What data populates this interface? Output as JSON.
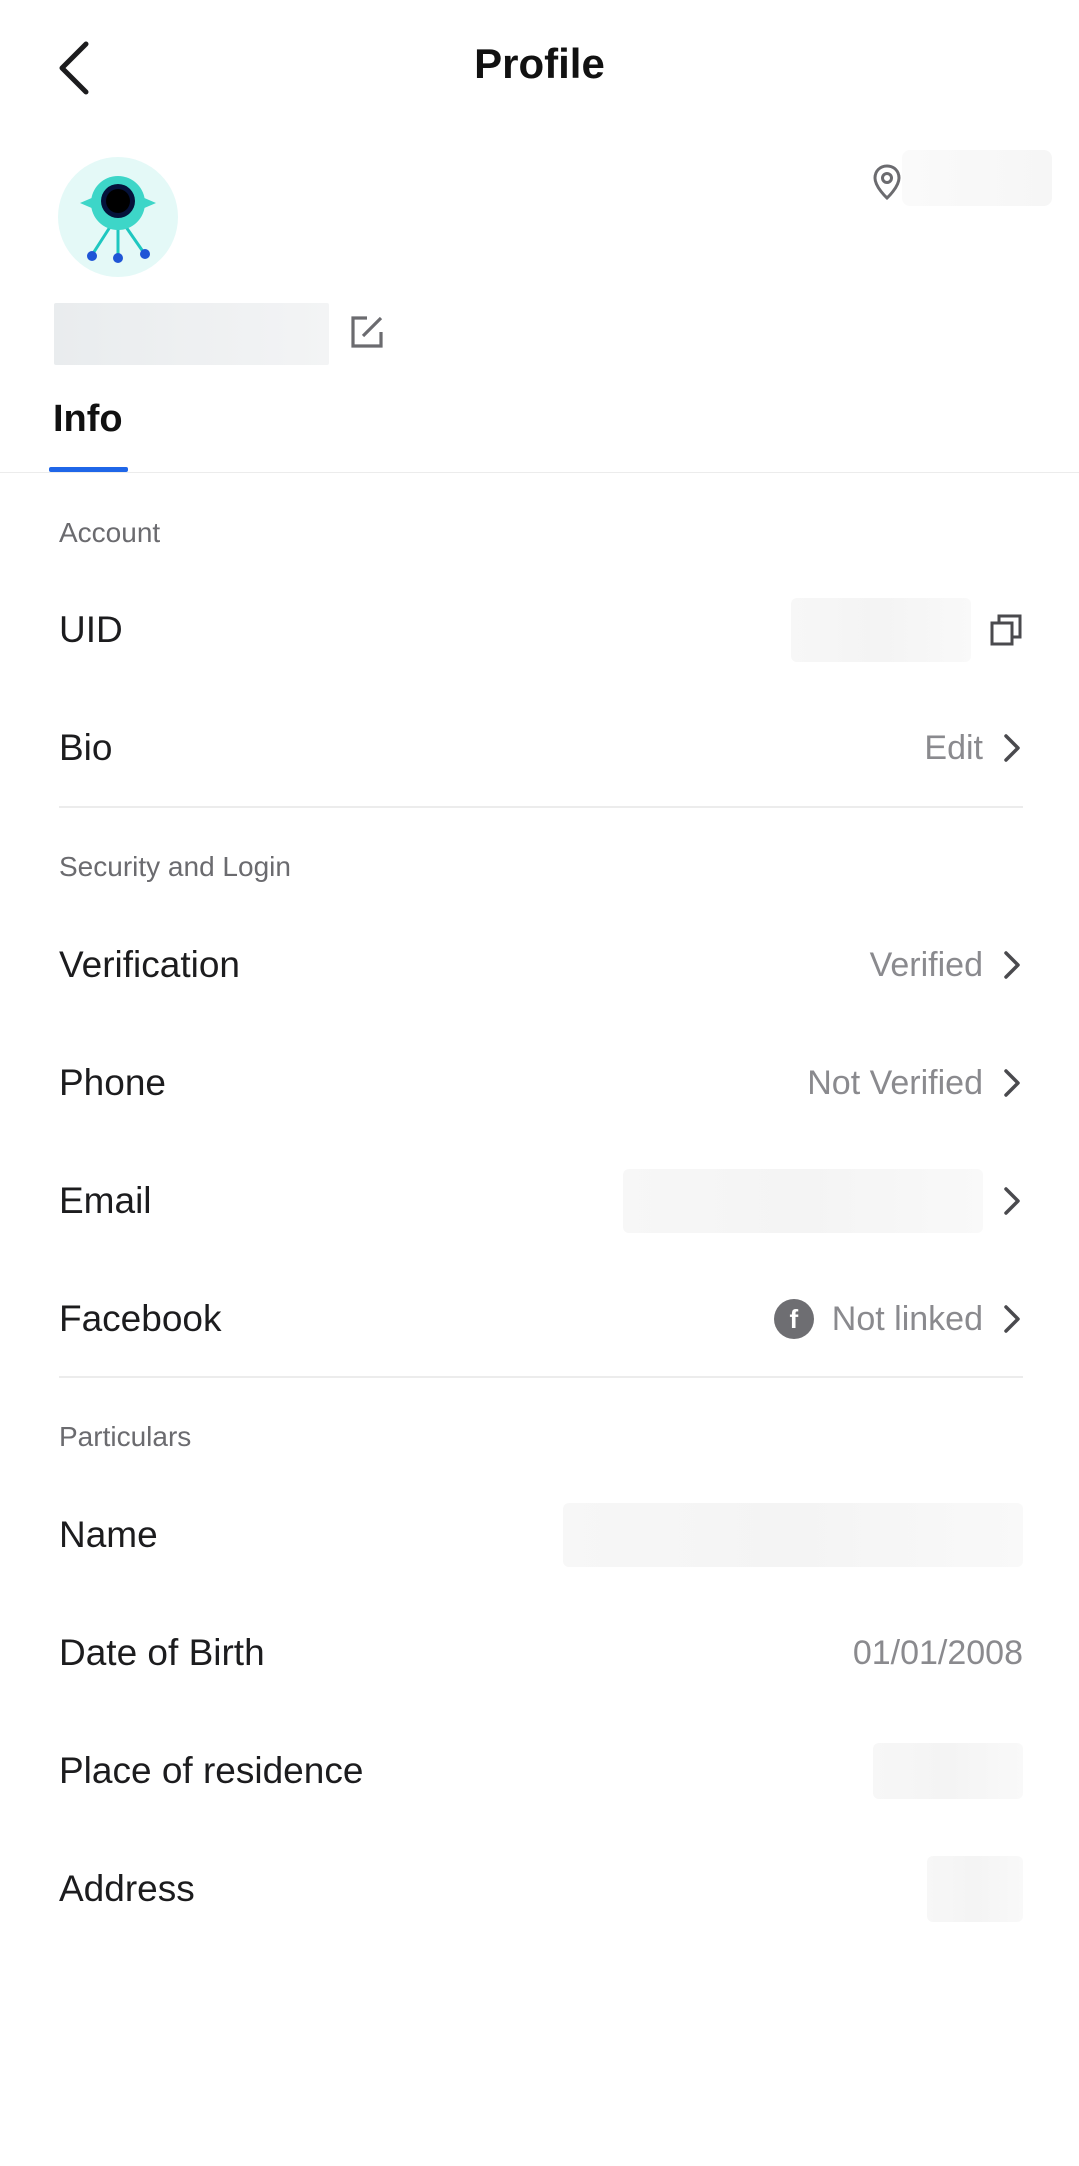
{
  "header": {
    "title": "Profile",
    "back_icon": "chevron-left-icon"
  },
  "profile": {
    "avatar_icon": "robot-avatar-icon",
    "location_icon": "location-pin-icon",
    "edit_icon": "edit-square-icon"
  },
  "tabs": {
    "info_label": "Info"
  },
  "sections": {
    "account": {
      "title": "Account",
      "uid_label": "UID",
      "bio_label": "Bio",
      "bio_value": "Edit"
    },
    "security": {
      "title": "Security and Login",
      "verification_label": "Verification",
      "verification_value": "Verified",
      "phone_label": "Phone",
      "phone_value": "Not Verified",
      "email_label": "Email",
      "facebook_label": "Facebook",
      "facebook_value": "Not linked",
      "facebook_icon_letter": "f"
    },
    "particulars": {
      "title": "Particulars",
      "name_label": "Name",
      "dob_label": "Date of Birth",
      "dob_value": "01/01/2008",
      "residence_label": "Place of residence",
      "address_label": "Address"
    }
  },
  "colors": {
    "accent": "#1f66e8",
    "avatar_bg": "#e4f9f7",
    "avatar_teal": "#3dd6c8",
    "secondary_text": "#8a8a8e"
  }
}
